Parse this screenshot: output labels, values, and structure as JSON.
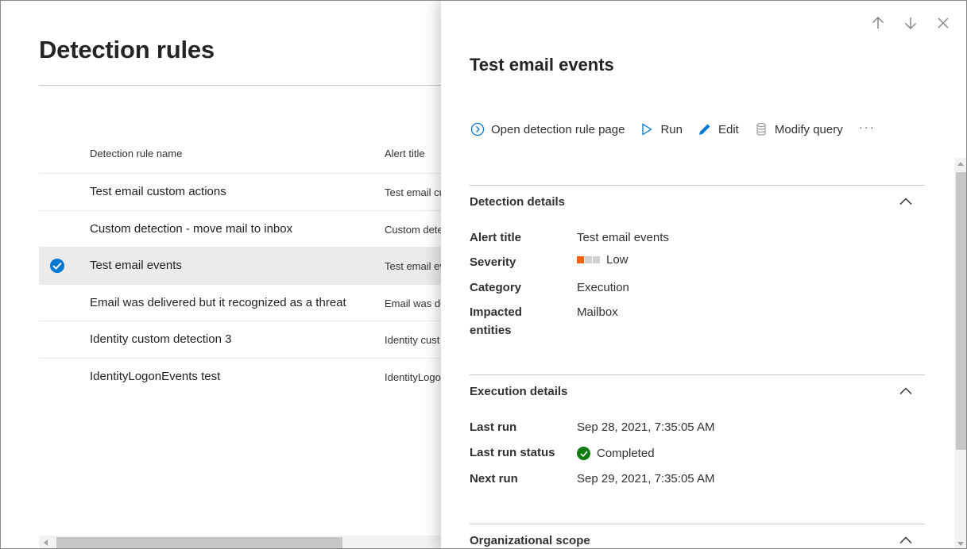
{
  "page": {
    "title": "Detection rules",
    "columns": {
      "name": "Detection rule name",
      "alert": "Alert title"
    },
    "rows": [
      {
        "name": "Test email custom actions",
        "alert": "Test email cu",
        "selected": false
      },
      {
        "name": "Custom detection - move mail to inbox",
        "alert": "Custom dete",
        "selected": false
      },
      {
        "name": "Test email events",
        "alert": "Test email ev",
        "selected": true
      },
      {
        "name": "Email was delivered but it recognized as a threat",
        "alert": "Email was de",
        "selected": false
      },
      {
        "name": "Identity custom detection 3",
        "alert": "Identity cust",
        "selected": false
      },
      {
        "name": "IdentityLogonEvents test",
        "alert": "IdentityLogo",
        "selected": false
      }
    ]
  },
  "panel": {
    "title": "Test email events",
    "toolbar": {
      "open": "Open detection rule page",
      "run": "Run",
      "edit": "Edit",
      "modify": "Modify query",
      "more": "···"
    },
    "detection": {
      "heading": "Detection details",
      "alert_title_label": "Alert title",
      "alert_title_value": "Test email events",
      "severity_label": "Severity",
      "severity_value": "Low",
      "category_label": "Category",
      "category_value": "Execution",
      "entities_label_1": "Impacted",
      "entities_label_2": "entities",
      "entities_value": "Mailbox"
    },
    "execution": {
      "heading": "Execution details",
      "last_run_label": "Last run",
      "last_run_value": "Sep 28, 2021, 7:35:05 AM",
      "status_label": "Last run status",
      "status_value": "Completed",
      "next_run_label": "Next run",
      "next_run_value": "Sep 29, 2021, 7:35:05 AM"
    },
    "scope": {
      "heading": "Organizational scope"
    }
  },
  "colors": {
    "accent": "#0078d4",
    "severity_low": "#f7630c",
    "severity_off": "#d2d0ce",
    "status_ok": "#107c10",
    "selected_row": "#edebe9"
  }
}
